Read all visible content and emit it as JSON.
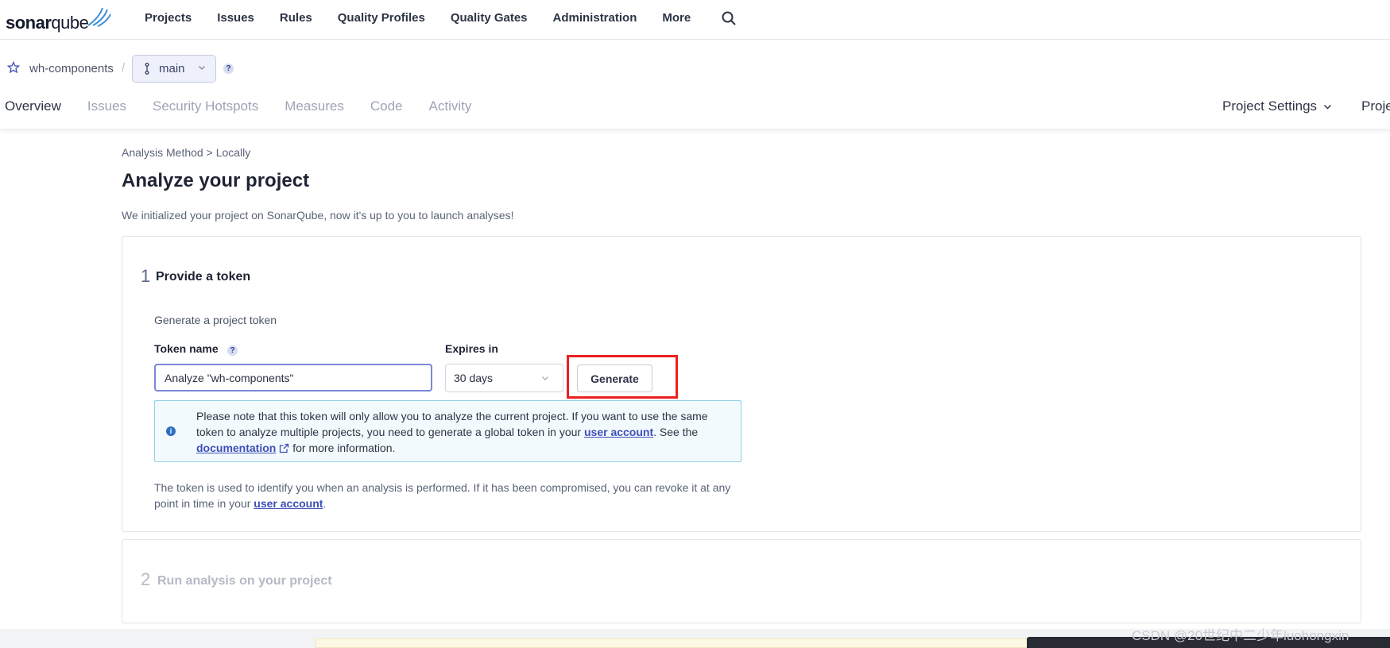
{
  "header": {
    "logo_part1": "sonar",
    "logo_part2": "qube",
    "nav": [
      "Projects",
      "Issues",
      "Rules",
      "Quality Profiles",
      "Quality Gates",
      "Administration",
      "More"
    ],
    "search_icon": "search-icon"
  },
  "project": {
    "name": "wh-components",
    "separator": "/",
    "branch": "main",
    "help": "?",
    "tabs": [
      "Overview",
      "Issues",
      "Security Hotspots",
      "Measures",
      "Code",
      "Activity"
    ],
    "active_tab": "Overview",
    "settings_label": "Project Settings",
    "info_label": "Proje"
  },
  "page": {
    "breadcrumb_method": "Analysis Method",
    "breadcrumb_sep": ">",
    "breadcrumb_current": "Locally",
    "title": "Analyze your project",
    "subtitle": "We initialized your project on SonarQube, now it's up to you to launch analyses!"
  },
  "step1": {
    "number": "1",
    "title": "Provide a token",
    "generate_label": "Generate a project token",
    "token_name_label": "Token name",
    "token_name_value": "Analyze \"wh-components\"",
    "expires_label": "Expires in",
    "expires_value": "30 days",
    "generate_button": "Generate",
    "note_part1": "Please note that this token will only allow you to analyze the current project. If you want to use the same token to analyze multiple projects, you need to generate a global token in your",
    "note_link1": "user account",
    "note_part2": ". See the",
    "note_link2": "documentation",
    "note_part3": "for more information.",
    "explain_part1": "The token is used to identify you when an analysis is performed. If it has been compromised, you can revoke it at any point in time in your",
    "explain_link": "user account",
    "explain_part2": "."
  },
  "step2": {
    "number": "2",
    "title": "Run analysis on your project"
  },
  "watermark": "CSDN @20世纪中二少年luohongxin",
  "colors": {
    "accent": "#3e4eb8",
    "highlight_box": "#ec1f1f",
    "note_border": "#8fd0e6"
  }
}
